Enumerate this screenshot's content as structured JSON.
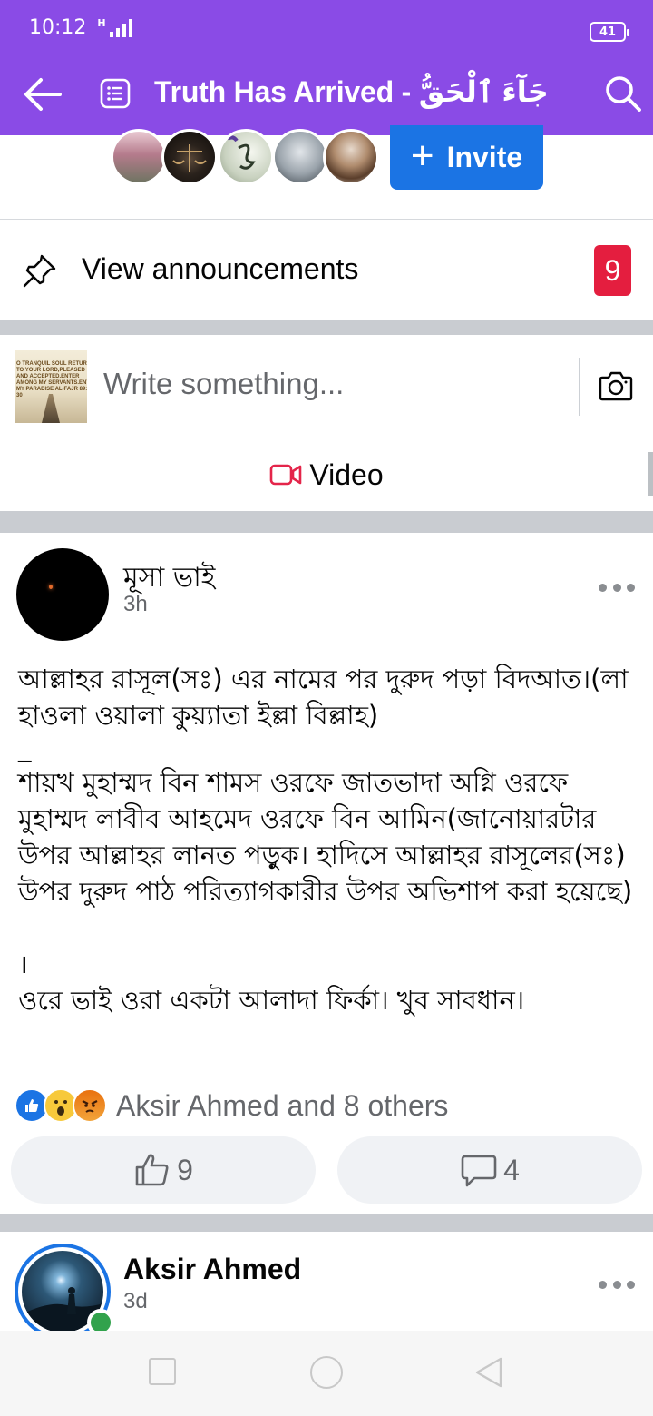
{
  "status_bar": {
    "time": "10:12",
    "network": "H",
    "battery": "41"
  },
  "header": {
    "title": "Truth Has Arrived - جَآءَ ٱلْحَقُّ"
  },
  "members": {
    "invite_label": "Invite"
  },
  "announcements": {
    "label": "View announcements",
    "count": "9"
  },
  "composer": {
    "placeholder": "Write something...",
    "thumbnail_text": "O TRANQUIL SOUL RETURN TO YOUR LORD,PLEASED AND ACCEPTED.ENTER AMONG MY SERVANTS.ENTER MY PARADISE AL-FAJR 89:27-30",
    "video_label": "Video"
  },
  "post1": {
    "author": "মূসা ভাই",
    "time": "3h",
    "body": [
      "আল্লাহর রাসূল(সঃ) এর নামের পর দুরুদ পড়া বিদআত।(লা হাওলা ওয়ালা কুয়্যাতা ইল্লা বিল্লাহ)",
      "_",
      "শায়খ মুহাম্মদ বিন শামস ওরফে জাতভাদা অগ্নি ওরফে মুহাম্মদ লাবীব আহমেদ ওরফে বিন আমিন(জানোয়ারটার উপর আল্লাহর লানত পড়ুক। হাদিসে আল্লাহর রাসূলের(সঃ) উপর দুরুদ পাঠ পরিত্যাগকারীর উপর অভিশাপ করা হয়েছে)",
      "",
      "।",
      "ওরে ভাই ওরা একটা আলাদা ফির্কা। খুব সাবধান।"
    ],
    "reactions_label": "Aksir Ahmed and 8 others",
    "like_count": "9",
    "comment_count": "4"
  },
  "post2": {
    "author": "Aksir Ahmed",
    "time": "3d"
  },
  "colors": {
    "header": "#8a4be6",
    "accent": "#1b74e4",
    "badge": "#e41e3f",
    "online": "#31a24c"
  }
}
